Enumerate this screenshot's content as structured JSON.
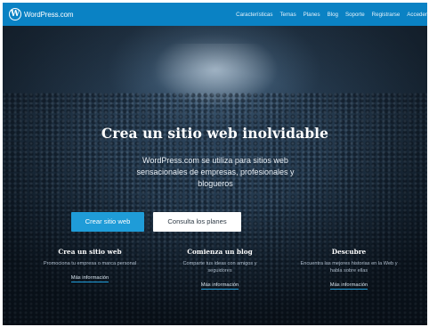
{
  "nav": {
    "brand": "WordPress.com",
    "logo_icon": "wordpress-logo-icon",
    "logo_letter": "W",
    "links": [
      "Características",
      "Temas",
      "Planes",
      "Blog",
      "Soporte",
      "Registrarse",
      "Acceder"
    ]
  },
  "hero": {
    "title": "Crea un sitio web inolvidable",
    "subtitle": "WordPress.com se utiliza para sitios web sensacionales de empresas, profesionales y blogueros",
    "primary_button": "Crear sitio web",
    "secondary_button": "Consulta los planes"
  },
  "features": [
    {
      "title": "Crea un sitio web",
      "text": "Promociona tu empresa o marca personal",
      "link": "Más información"
    },
    {
      "title": "Comienza un blog",
      "text": "Comparte tus ideas con amigos y seguidores",
      "link": "Más información"
    },
    {
      "title": "Descubre",
      "text": "Encuentra las mejores historias en la Web y habla sobre ellas",
      "link": "Más información"
    }
  ],
  "colors": {
    "nav_bar": "#0a82c4",
    "primary_button": "#1f9cd8",
    "hero_background": "#1b2c3c"
  }
}
